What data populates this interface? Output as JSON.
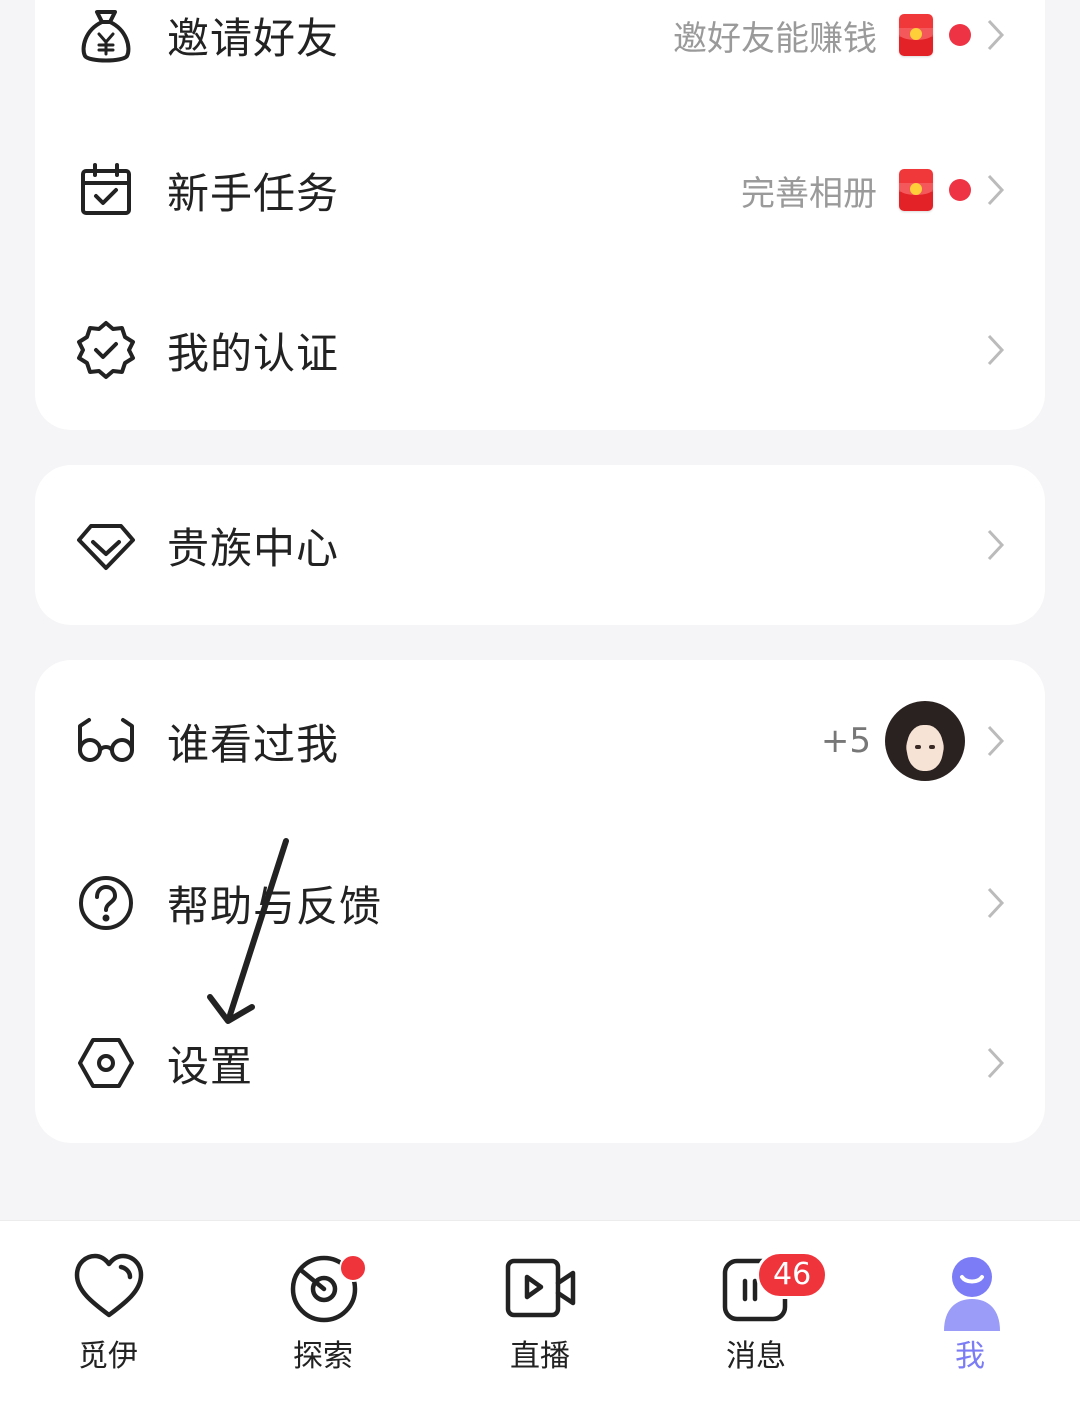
{
  "menu_groups": [
    {
      "items": [
        {
          "label": "邀请好友",
          "hint": "邀好友能赚钱",
          "icon": "money-bag-icon"
        },
        {
          "label": "新手任务",
          "hint": "完善相册",
          "icon": "calendar-check-icon"
        },
        {
          "label": "我的认证",
          "icon": "verified-badge-icon"
        }
      ]
    },
    {
      "items": [
        {
          "label": "贵族中心",
          "icon": "diamond-icon"
        }
      ]
    },
    {
      "items": [
        {
          "label": "谁看过我",
          "extra": "+5",
          "icon": "glasses-icon"
        },
        {
          "label": "帮助与反馈",
          "icon": "question-circle-icon"
        },
        {
          "label": "设置",
          "icon": "hexagon-settings-icon"
        }
      ]
    }
  ],
  "tabbar": [
    {
      "label": "觅伊",
      "icon": "heart-icon"
    },
    {
      "label": "探索",
      "icon": "explore-disc-icon"
    },
    {
      "label": "直播",
      "icon": "video-camera-icon"
    },
    {
      "label": "消息",
      "icon": "message-icon",
      "badge": "46"
    },
    {
      "label": "我",
      "icon": "user-avatar-icon",
      "active": true
    }
  ],
  "colors": {
    "accent_red": "#ee3344",
    "active_tab": "#7b7cf6",
    "background": "#f5f5f7"
  }
}
